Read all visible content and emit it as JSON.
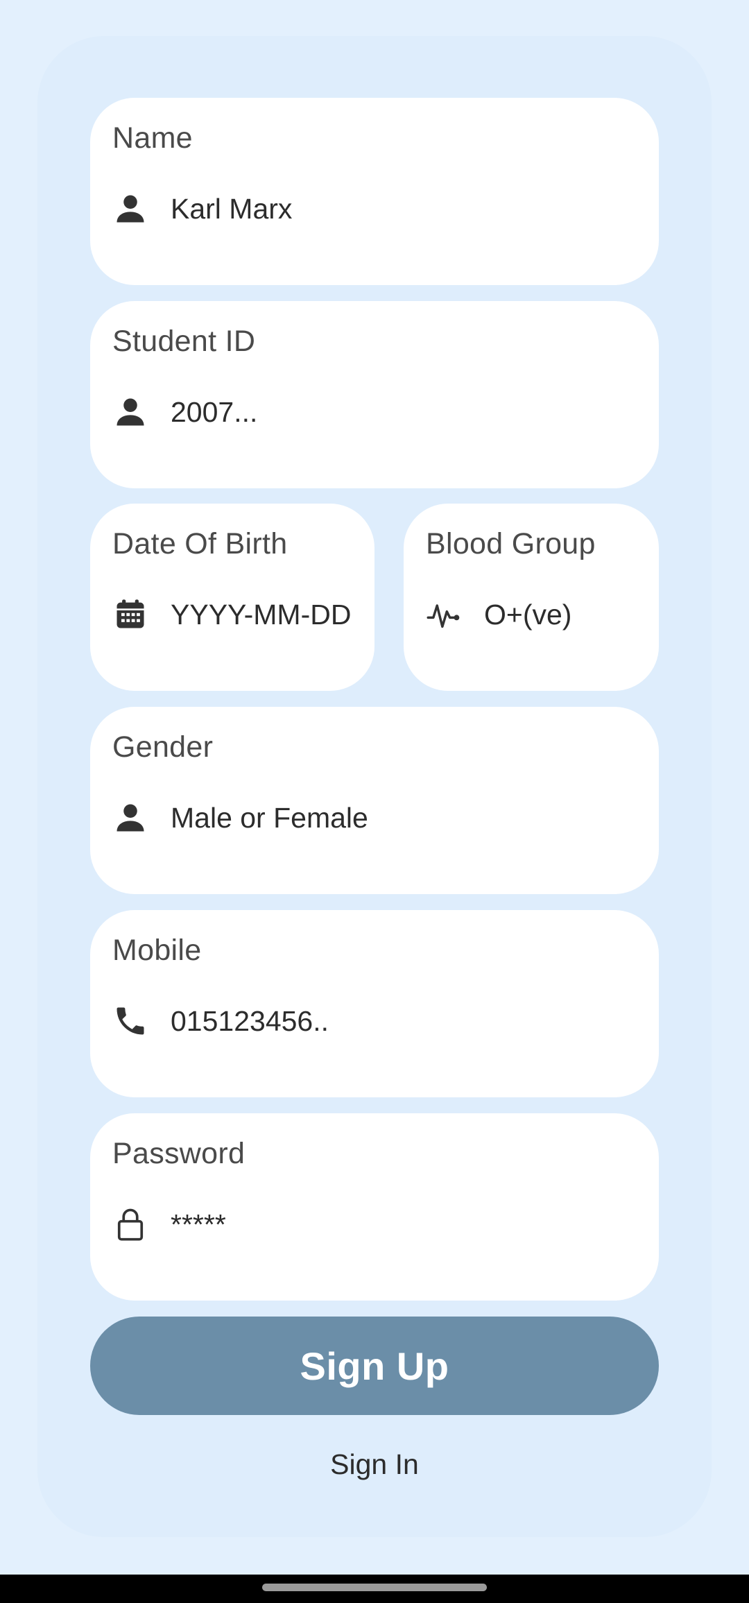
{
  "form": {
    "name": {
      "label": "Name",
      "value": "Karl Marx",
      "icon": "person-icon"
    },
    "student_id": {
      "label": "Student ID",
      "placeholder": "2007...",
      "icon": "person-icon"
    },
    "dob": {
      "label": "Date Of Birth",
      "placeholder": "YYYY-MM-DD",
      "icon": "calendar-icon"
    },
    "blood_group": {
      "label": "Blood Group",
      "placeholder": "O+(ve)",
      "icon": "pulse-icon"
    },
    "gender": {
      "label": "Gender",
      "placeholder": "Male or Female",
      "icon": "person-icon"
    },
    "mobile": {
      "label": "Mobile",
      "placeholder": "015123456..",
      "icon": "phone-icon"
    },
    "password": {
      "label": "Password",
      "placeholder": "*****",
      "icon": "lock-icon"
    }
  },
  "actions": {
    "signup_label": "Sign Up",
    "signin_label": "Sign In"
  },
  "colors": {
    "background": "#e3f0fd",
    "card": "#deedfc",
    "button": "#6b8ea8"
  }
}
